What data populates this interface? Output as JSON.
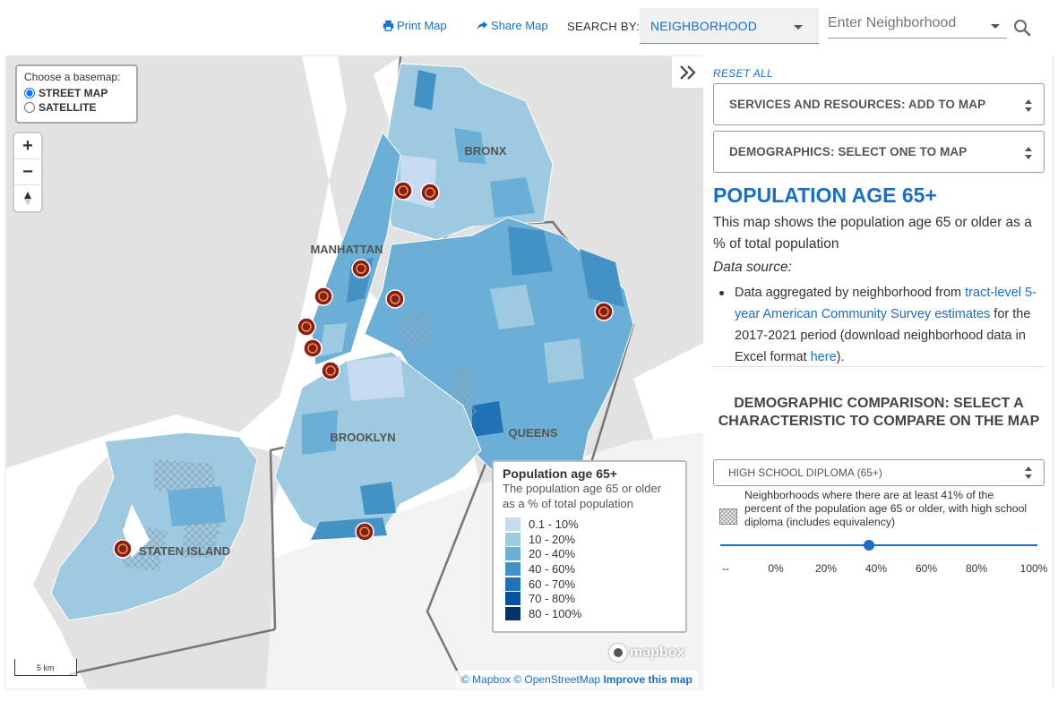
{
  "header": {
    "print_label": "Print Map",
    "share_label": "Share Map",
    "search_by_label": "SEARCH BY:",
    "search_by_value": "NEIGHBORHOOD",
    "neighborhood_placeholder": "Enter Neighborhood"
  },
  "map": {
    "basemap_title": "Choose a basemap:",
    "basemap_options": [
      "STREET MAP",
      "SATELLITE"
    ],
    "basemap_selected": "STREET MAP",
    "zoom_in": "+",
    "zoom_out": "−",
    "boroughs": [
      "BRONX",
      "MANHATTAN",
      "QUEENS",
      "BROOKLYN",
      "STATEN ISLAND"
    ],
    "scale_label": "5 km",
    "mapbox_logo": "mapbox",
    "attribution": {
      "mapbox": "© Mapbox",
      "osm": "© OpenStreetMap",
      "improve": "Improve this map"
    },
    "colors": {
      "water": "#ffffff",
      "land": "#e6e6e6",
      "marker": "#8b1a1a"
    }
  },
  "legend": {
    "title": "Population age 65+",
    "subtitle": "The population age 65 or older as a % of total population",
    "classes": [
      {
        "label": "0.1 - 10%",
        "color": "#c6dbef"
      },
      {
        "label": "10 - 20%",
        "color": "#9ecae1"
      },
      {
        "label": "20 - 40%",
        "color": "#6baed6"
      },
      {
        "label": "40 - 60%",
        "color": "#4292c6"
      },
      {
        "label": "60 - 70%",
        "color": "#2171b5"
      },
      {
        "label": "70 - 80%",
        "color": "#08519c"
      },
      {
        "label": "80 - 100%",
        "color": "#08306b"
      }
    ]
  },
  "panel": {
    "expand_icon": "double-chevron-right-icon",
    "reset_label": "RESET ALL",
    "services_label": "SERVICES AND RESOURCES: ADD TO MAP",
    "demographics_label": "DEMOGRAPHICS: SELECT ONE TO MAP",
    "title": "POPULATION AGE 65+",
    "description": "This map shows the population age 65 or older as a % of total population",
    "data_source_label": "Data source:",
    "source_text_1": "Data aggregated by neighborhood from ",
    "source_link_1": "tract-level 5-year American Community Survey estimates",
    "source_text_2": " for the 2017-2021 period (download neighborhood data in Excel format ",
    "source_link_2": "here",
    "source_text_3": ").",
    "comparison_title": "DEMOGRAPHIC COMPARISON: SELECT A CHARACTERISTIC TO COMPARE ON THE MAP",
    "comparison_value": "HIGH SCHOOL DIPLOMA (65+)",
    "hatch_note": "Neighborhoods where there are at least 41% of the percent of the population age 65 or older, with high school diploma (includes equivalency)",
    "slider_value_percent": 41,
    "slider_ticks": [
      "--",
      "0%",
      "20%",
      "40%",
      "60%",
      "80%",
      "100%"
    ]
  }
}
